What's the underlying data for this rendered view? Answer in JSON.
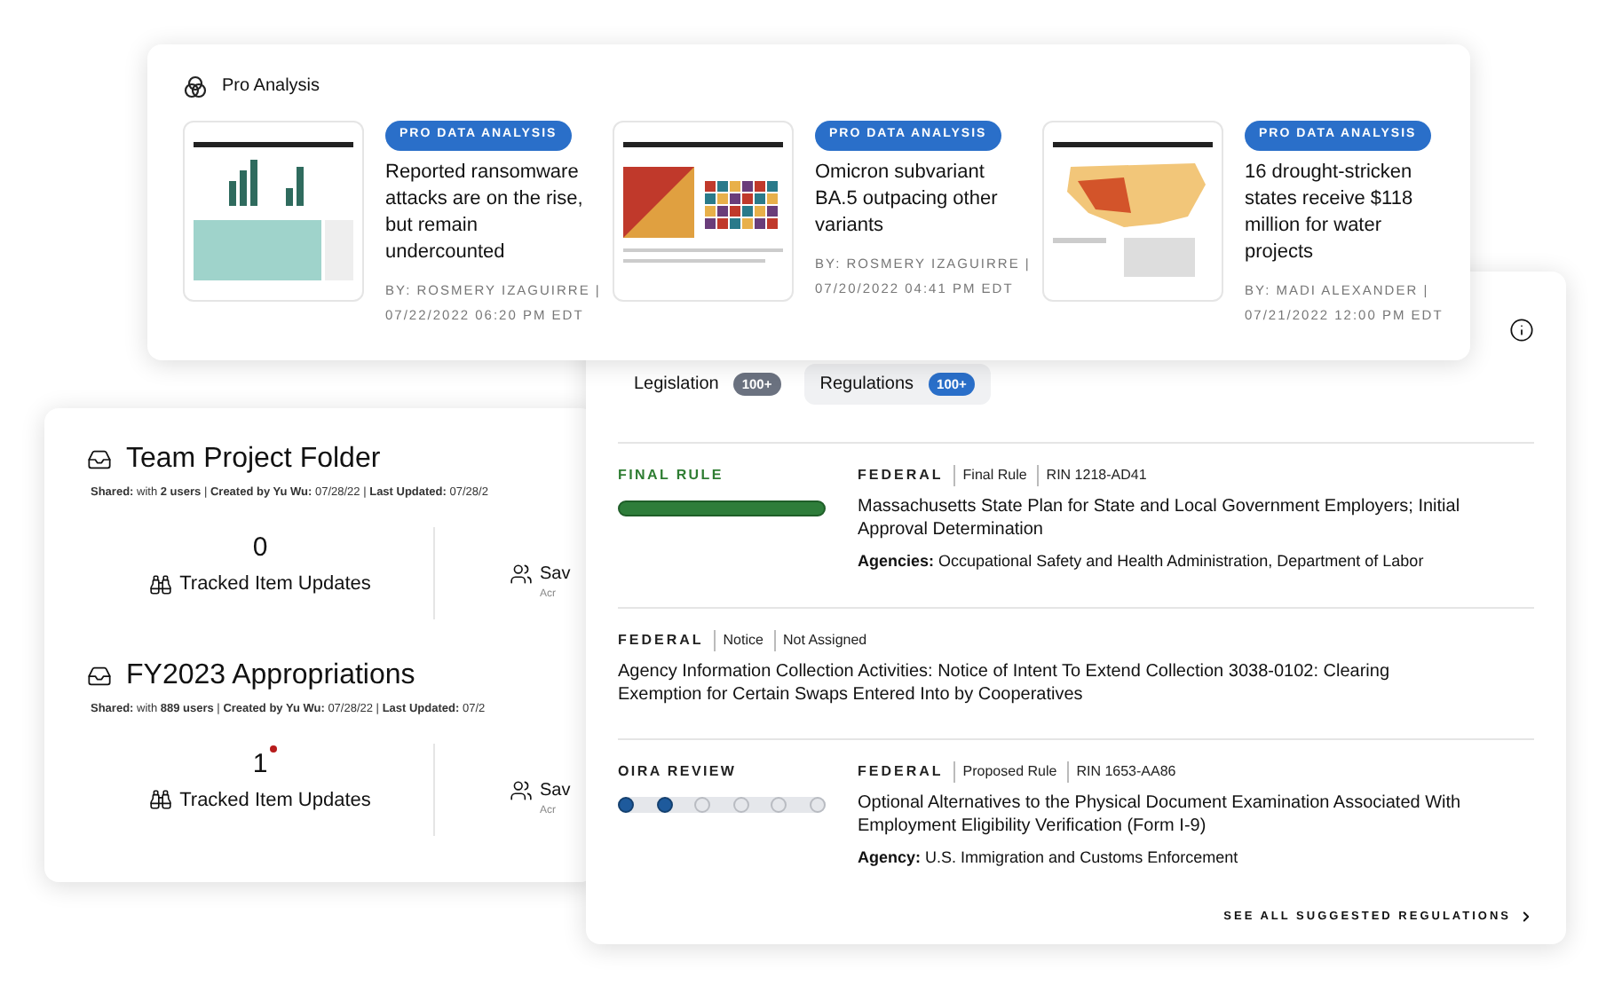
{
  "pro_analysis": {
    "title": "Pro Analysis",
    "articles": [
      {
        "badge": "PRO DATA ANALYSIS",
        "title": "Reported ransomware attacks are on the rise, but remain undercounted",
        "byline": "BY: ROSMERY IZAGUIRRE |",
        "date": "07/22/2022 06:20 PM EDT",
        "kind": "bars"
      },
      {
        "badge": "PRO DATA ANALYSIS",
        "title": "Omicron subvariant BA.5 outpacing other variants",
        "byline": "BY: ROSMERY IZAGUIRRE |",
        "date": "07/20/2022 04:41 PM EDT",
        "kind": "area"
      },
      {
        "badge": "PRO DATA ANALYSIS",
        "title": "16 drought-stricken states receive $118 million for water projects",
        "byline": "BY: MADI ALEXANDER |",
        "date": "07/21/2022 12:00 PM EDT",
        "kind": "map"
      }
    ]
  },
  "folders": [
    {
      "title": "Team Project Folder",
      "meta": "**Shared:** with **2 users** | **Created by Yu Wu:** 07/28/22 | **Last Updated:** 07/28/2",
      "count": "0",
      "new_indicator": false,
      "stat_label": "Tracked Item Updates",
      "stat2_label": "Sav",
      "stat2_sub": "Acr"
    },
    {
      "title": "FY2023 Appropriations",
      "meta": "**Shared:** with **889 users** | **Created by Yu Wu:** 07/28/22 | **Last Updated:** 07/2",
      "count": "1",
      "new_indicator": true,
      "stat_label": "Tracked Item Updates",
      "stat2_label": "Sav",
      "stat2_sub": "Acr"
    }
  ],
  "tabs": [
    {
      "label": "Legislation",
      "count": "100+",
      "selected": false
    },
    {
      "label": "Regulations",
      "count": "100+",
      "selected": true
    }
  ],
  "regulations": [
    {
      "kind": "progress",
      "stage": "FINAL RULE",
      "level": 1,
      "jurisdiction": "FEDERAL",
      "type": "Final Rule",
      "rin": "RIN 1218-AD41",
      "title": "Massachusetts State Plan for State and Local Government Employers; Initial Approval Determination",
      "agency_label": "Agencies:",
      "agency": "Occupational Safety and Health Administration, Department of Labor"
    },
    {
      "kind": "plain",
      "jurisdiction": "FEDERAL",
      "type": "Notice",
      "rin": "Not Assigned",
      "title": "Agency Information Collection Activities: Notice of Intent To Extend Collection 3038-0102: Clearing Exemption for Certain Swaps Entered Into by Cooperatives"
    },
    {
      "kind": "steps",
      "stage": "OIRA REVIEW",
      "steps": [
        {
          "done": true
        },
        {
          "done": true
        },
        {
          "done": false
        },
        {
          "done": false
        },
        {
          "done": false
        },
        {
          "done": false
        }
      ],
      "jurisdiction": "FEDERAL",
      "type": "Proposed Rule",
      "rin": "RIN 1653-AA86",
      "title": "Optional Alternatives to the Physical Document Examination Associated With Employment Eligibility Verification (Form I-9)",
      "agency_label": "Agency:",
      "agency": "U.S. Immigration and Customs Enforcement"
    }
  ],
  "see_all": "SEE ALL SUGGESTED REGULATIONS"
}
